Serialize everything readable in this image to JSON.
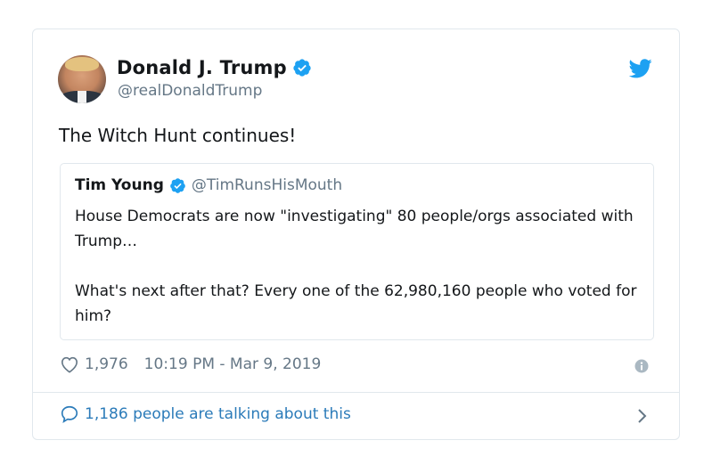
{
  "tweet": {
    "author_name": "Donald J. Trump",
    "author_handle": "@realDonaldTrump",
    "text": "The Witch Hunt continues!",
    "likes": "1,976",
    "timestamp": "10:19 PM - Mar 9, 2019",
    "talking": "1,186 people are talking about this",
    "icons": {
      "verified": "verified-badge-icon",
      "brand": "twitter-bird-icon",
      "like": "heart-icon",
      "info": "info-icon",
      "reply": "speech-bubble-icon",
      "more": "chevron-right-icon"
    }
  },
  "quoted": {
    "author_name": "Tim Young",
    "author_handle": "@TimRunsHisMouth",
    "paragraphs": [
      "House Democrats are now \"investigating\" 80 people/orgs associated with Trump…",
      "What's next after that? Every one of the 62,980,160 people who voted for him?"
    ]
  },
  "colors": {
    "accent": "#1da1f2",
    "link": "#2b7bb9",
    "muted": "#657786",
    "text": "#14171a",
    "border": "#e1e8ed"
  }
}
